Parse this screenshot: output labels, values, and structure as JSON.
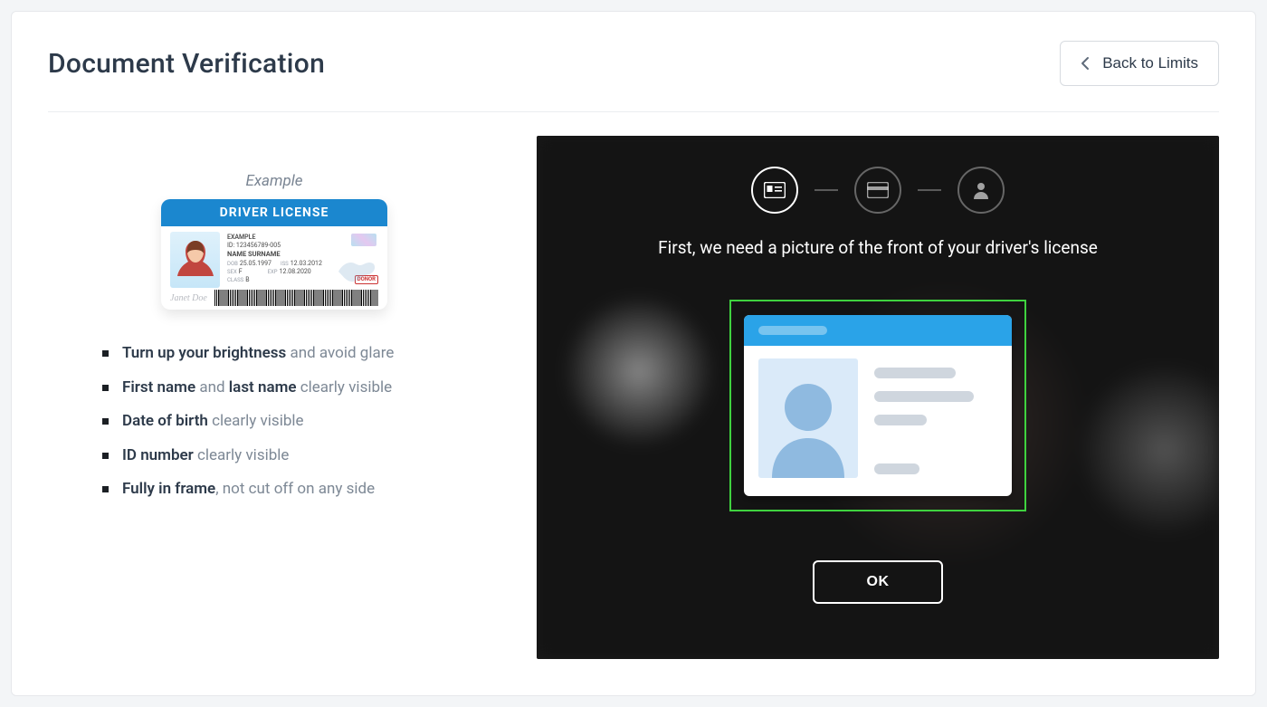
{
  "header": {
    "title": "Document Verification",
    "back_label": "Back to Limits"
  },
  "example": {
    "caption": "Example",
    "card_title": "DRIVER LICENSE",
    "fields": {
      "example_line": "EXAMPLE",
      "id_line": "ID: 123456789-005",
      "name_line": "NAME SURNAME",
      "dob_label": "DOB",
      "dob_value": "25.05.1997",
      "iss_label": "ISS",
      "iss_value": "12.03.2012",
      "sex_label": "SEX",
      "sex_value": "F",
      "exp_label": "EXP",
      "exp_value": "12.08.2020",
      "class_label": "CLASS",
      "class_value": "B",
      "donor": "DONOR",
      "signature": "Janet Doe"
    }
  },
  "requirements": [
    {
      "bold_a": "Turn up your brightness",
      "plain_a": " and avoid glare"
    },
    {
      "bold_a": "First name",
      "plain_a": " and ",
      "bold_b": "last name",
      "plain_b": " clearly visible"
    },
    {
      "bold_a": "Date of birth",
      "plain_a": " clearly visible"
    },
    {
      "bold_a": "ID number",
      "plain_a": " clearly visible"
    },
    {
      "bold_a": "Fully in frame",
      "plain_a": ", not cut off on any side"
    }
  ],
  "camera": {
    "instruction": "First, we need a picture of the front of your driver's license",
    "ok_label": "OK",
    "steps": [
      "id-front",
      "id-back",
      "selfie"
    ]
  }
}
